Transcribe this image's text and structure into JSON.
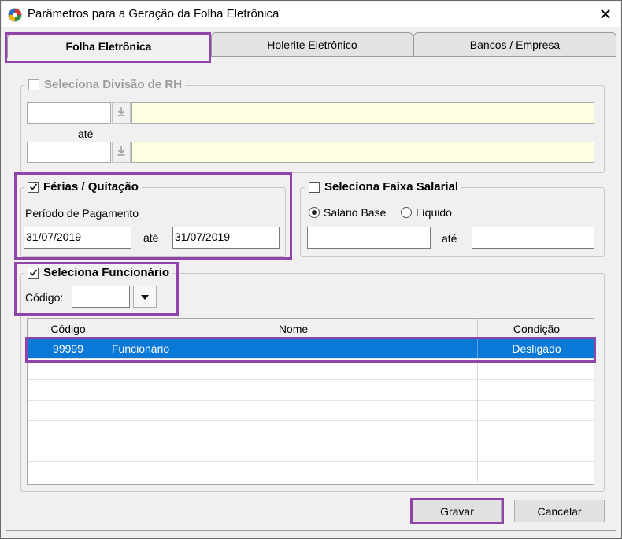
{
  "window": {
    "title": "Parâmetros para a Geração da Folha Eletrônica",
    "close_glyph": "✕"
  },
  "tabs": [
    {
      "label": "Folha Eletrônica",
      "active": true
    },
    {
      "label": "Holerite Eletrônico",
      "active": false
    },
    {
      "label": "Bancos / Empresa",
      "active": false
    }
  ],
  "divisao_rh": {
    "label": "Seleciona Divisão de RH",
    "checked": false,
    "enabled": false,
    "from_code": "",
    "from_desc": "",
    "until_label": "até",
    "to_code": "",
    "to_desc": ""
  },
  "ferias": {
    "label": "Férias / Quitação",
    "checked": true,
    "period_label": "Período de Pagamento",
    "start_date": "31/07/2019",
    "until_label": "até",
    "end_date": "31/07/2019"
  },
  "faixa_salarial": {
    "label": "Seleciona Faixa Salarial",
    "checked": false,
    "options": [
      "Salário Base",
      "Líquido"
    ],
    "selected": "Salário Base",
    "from_value": "",
    "until_label": "até",
    "to_value": ""
  },
  "funcionario": {
    "label": "Seleciona Funcionário",
    "checked": true,
    "code_label": "Código:",
    "code_value": ""
  },
  "grid": {
    "columns": [
      "Código",
      "Nome",
      "Condição"
    ],
    "rows": [
      {
        "codigo": "99999",
        "nome": "Funcionário",
        "condicao": "Desligado",
        "selected": true
      }
    ],
    "empty_rows": 6
  },
  "buttons": {
    "save": "Gravar",
    "cancel": "Cancelar"
  },
  "colors": {
    "highlight": "#8e44a8",
    "selection": "#0a78d7",
    "readonly_field": "#ffffe1"
  },
  "icons": {
    "app": "app-logo-icon",
    "close": "close-icon",
    "lookup": "download-arrow-icon",
    "dropdown": "dropdown-arrow-icon"
  }
}
